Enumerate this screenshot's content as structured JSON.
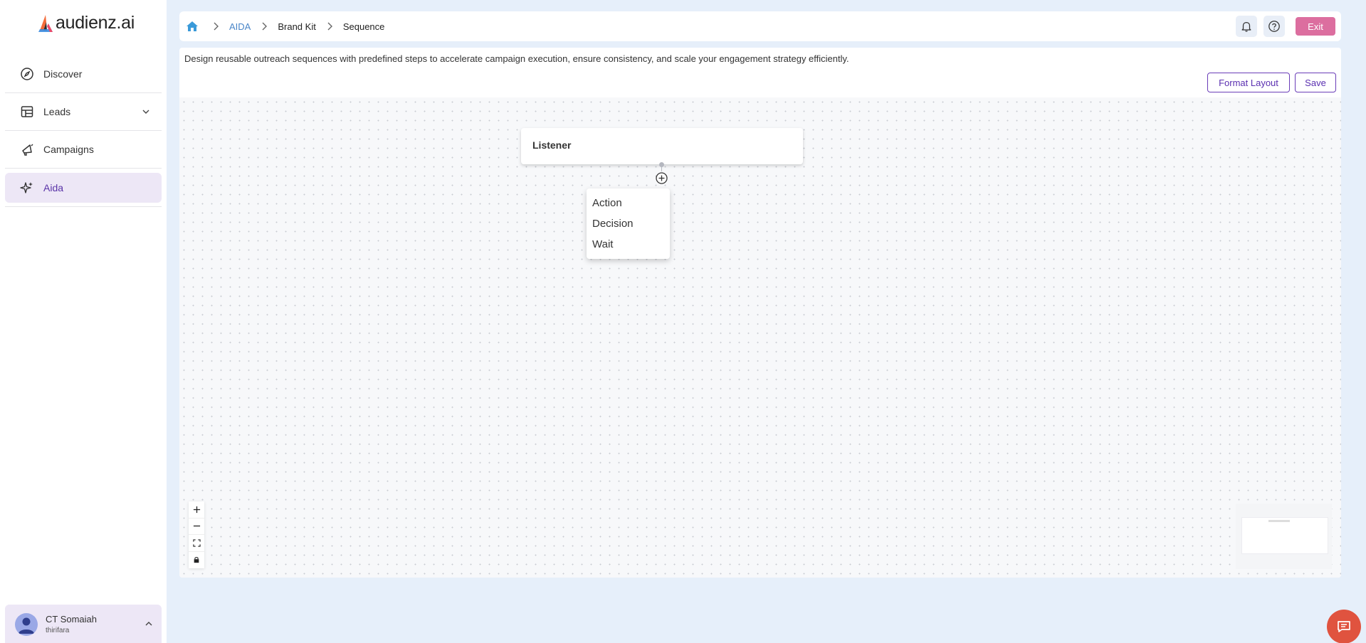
{
  "app": {
    "logo_text": "audienz.ai"
  },
  "sidebar": {
    "items": [
      {
        "label": "Discover",
        "icon": "compass-icon"
      },
      {
        "label": "Leads",
        "icon": "table-icon"
      },
      {
        "label": "Campaigns",
        "icon": "megaphone-icon"
      },
      {
        "label": "Aida",
        "icon": "sparkles-icon",
        "active": true
      }
    ],
    "user": {
      "name": "CT Somaiah",
      "sub": "thirifara"
    }
  },
  "header": {
    "breadcrumbs": [
      "AIDA",
      "Brand Kit",
      "Sequence"
    ],
    "exit_label": "Exit"
  },
  "main": {
    "description": "Design reusable outreach sequences with predefined steps to accelerate campaign execution, ensure consistency, and scale your engagement strategy efficiently.",
    "format_layout_label": "Format Layout",
    "save_label": "Save",
    "node_title": "Listener",
    "menu": [
      "Action",
      "Decision",
      "Wait"
    ]
  },
  "colors": {
    "accent": "#5a2fb0",
    "exit": "#dc6e9f",
    "chat": "#e0533f",
    "background": "#e6effa"
  }
}
